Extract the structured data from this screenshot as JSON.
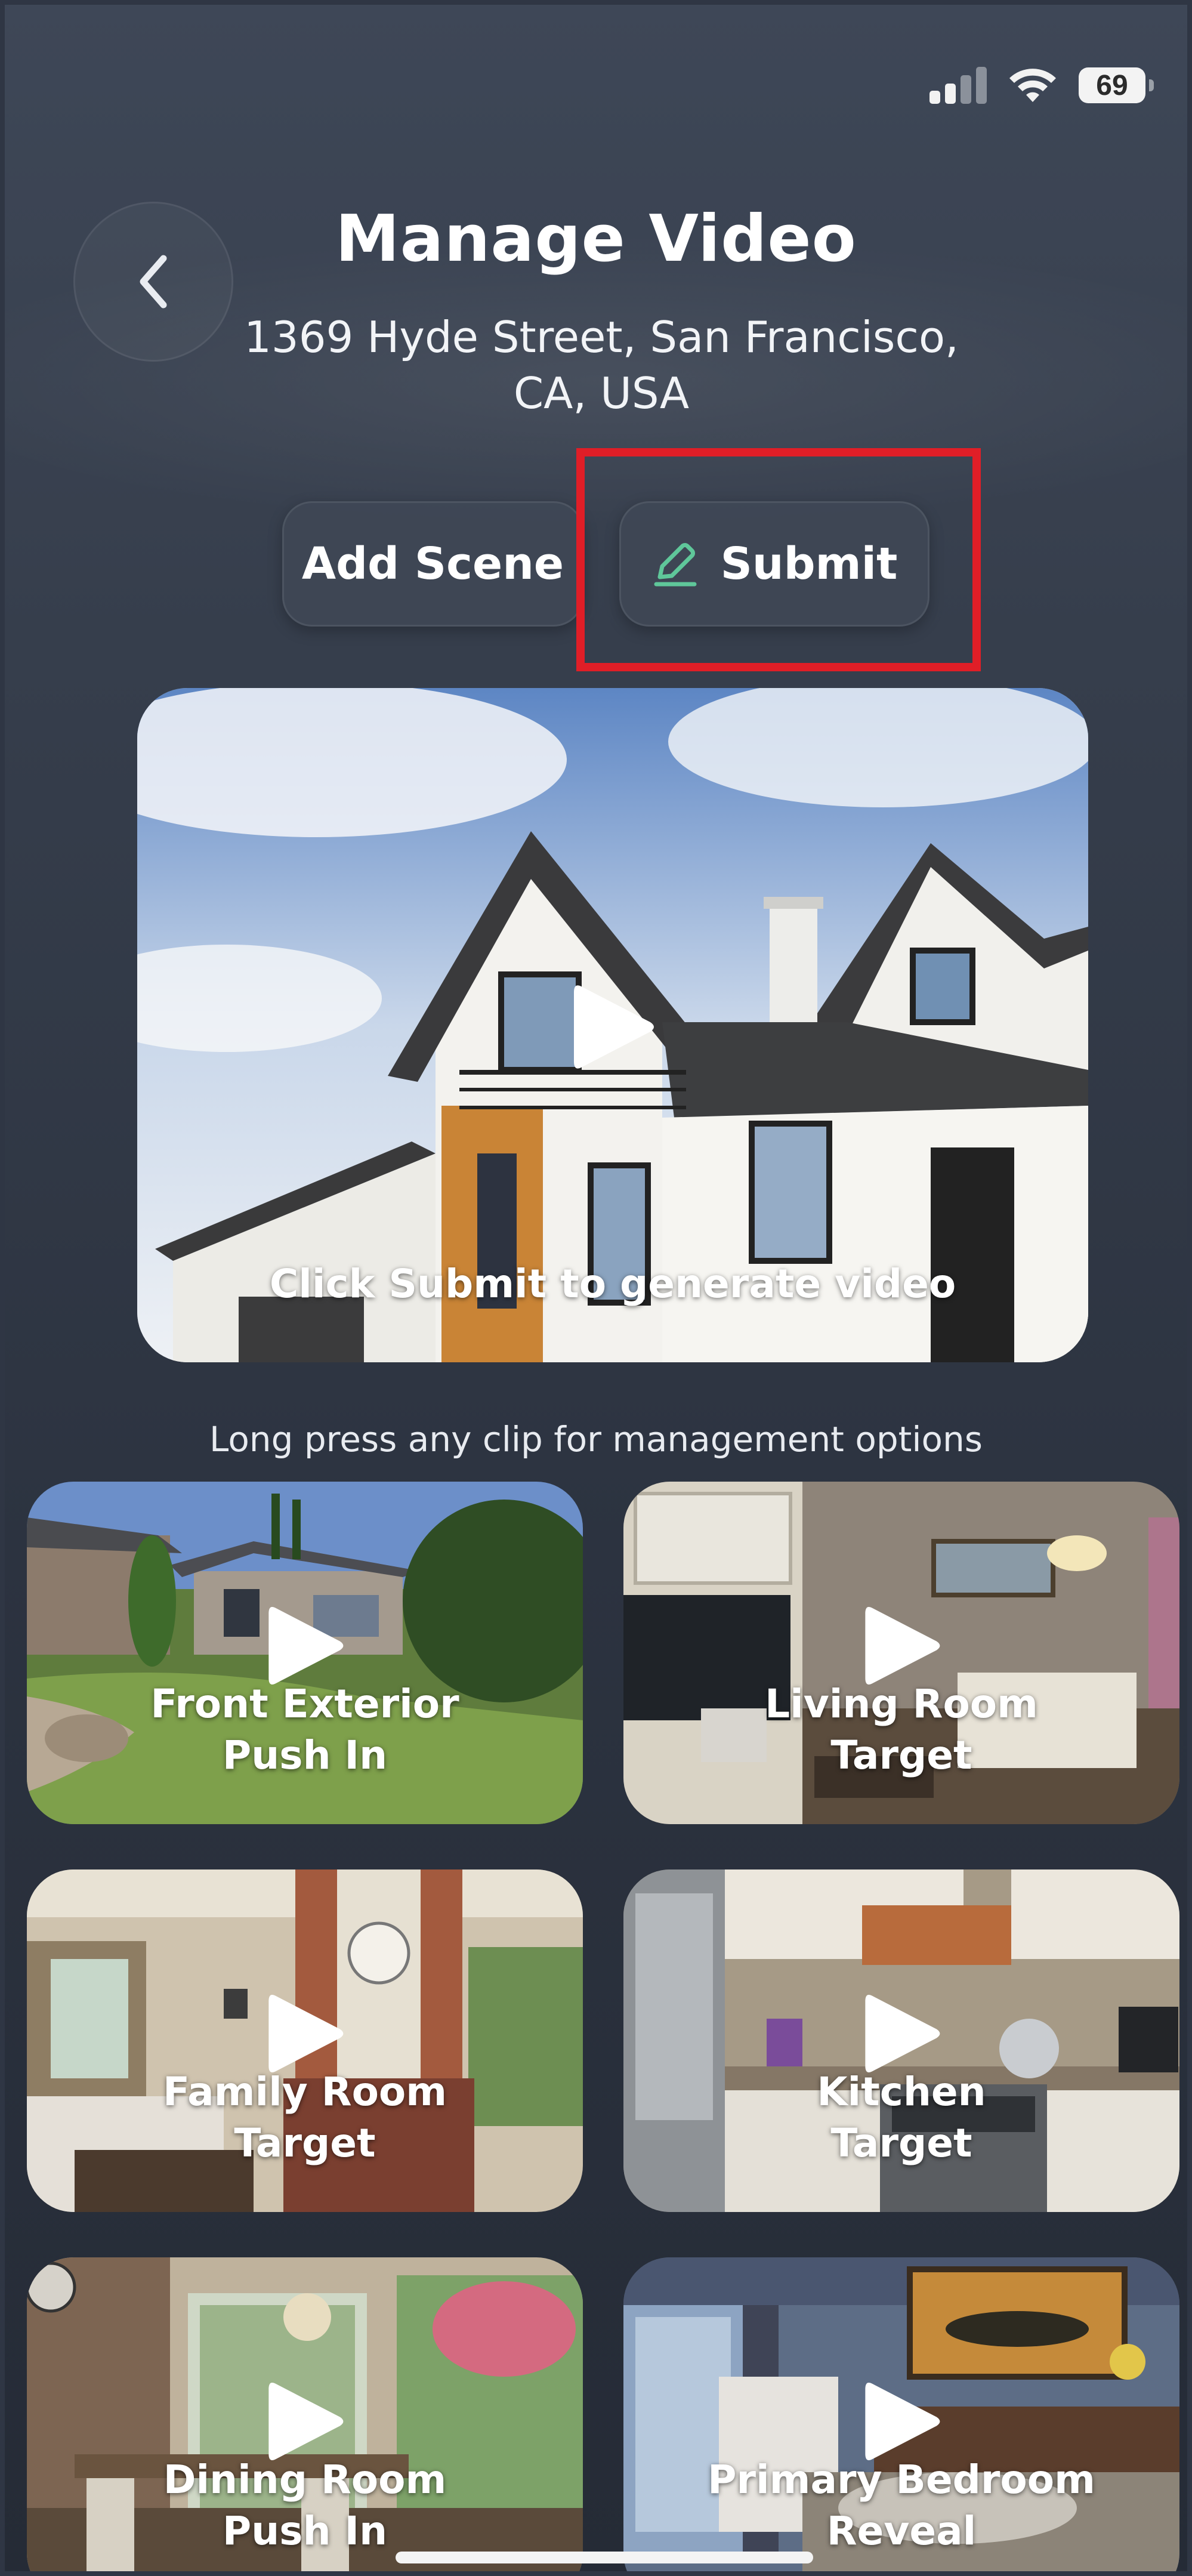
{
  "status_bar": {
    "battery": "69",
    "signal_icon": "cellular-signal-icon",
    "wifi_icon": "wifi-icon"
  },
  "header": {
    "back_icon": "chevron-left-icon",
    "title": "Manage Video",
    "address_line1": "1369 Hyde Street, San Francisco,",
    "address_line2": "CA, USA"
  },
  "actions": {
    "add_scene_label": "Add Scene",
    "submit_label": "Submit",
    "submit_icon": "pencil-icon",
    "accent_color": "#5fc79a",
    "highlight_color": "#e01e27"
  },
  "preview": {
    "caption": "Click Submit to generate video",
    "play_icon": "play-icon"
  },
  "hint": "Long press any clip for management options",
  "clips": [
    {
      "line1": "Front Exterior",
      "line2": "Push In"
    },
    {
      "line1": "Living Room",
      "line2": "Target"
    },
    {
      "line1": "Family Room",
      "line2": "Target"
    },
    {
      "line1": "Kitchen",
      "line2": "Target"
    },
    {
      "line1": "Dining Room",
      "line2": "Push In"
    },
    {
      "line1": "Primary Bedroom",
      "line2": "Reveal"
    }
  ]
}
